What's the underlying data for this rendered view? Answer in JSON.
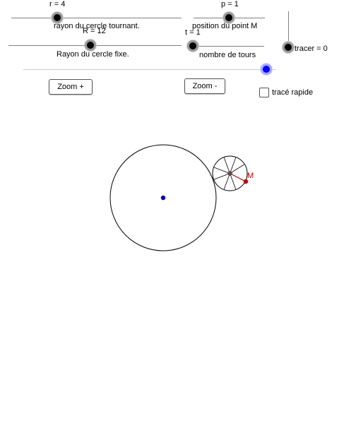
{
  "sliders": {
    "r": {
      "label": "r = 4",
      "caption": "rayon du cercle tournant.",
      "value": 4
    },
    "p": {
      "label": "p = 1",
      "caption": "position du point M",
      "value": 1
    },
    "R": {
      "label": "R = 12",
      "caption": "Rayon du cercle fixe.",
      "value": 12
    },
    "t": {
      "label": "t = 1",
      "caption": "nombre de tours",
      "value": 1
    },
    "tracer": {
      "label": "tracer = 0",
      "value": 0
    },
    "blue": {
      "value": 1
    }
  },
  "buttons": {
    "zoom_in": "Zoom +",
    "zoom_out": "Zoom -"
  },
  "checkbox": {
    "label": "tracé rapide",
    "checked": false
  },
  "canvas": {
    "point_label": "M",
    "colors": {
      "center_point": "#0000cc",
      "point_m": "#cc0000",
      "segment_m": "#cc0000",
      "stroke": "#000000"
    }
  }
}
